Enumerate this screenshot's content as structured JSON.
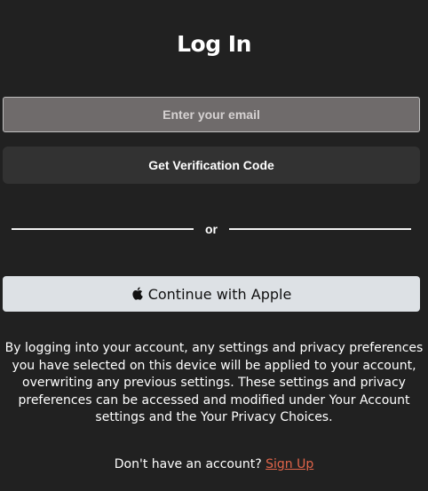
{
  "header": {
    "title": "Log In"
  },
  "form": {
    "email_placeholder": "Enter your email",
    "email_value": "",
    "verify_button_label": "Get Verification Code",
    "divider_text": "or",
    "apple_button_label": "Continue with Apple",
    "apple_icon": "apple-logo-icon"
  },
  "disclaimer": {
    "text": "By logging into your account, any settings and privacy preferences you have selected on this device will be applied to your account, overwriting any previous settings. These settings and privacy preferences can be accessed and modified under Your Account settings and the Your Privacy Choices."
  },
  "footer": {
    "prompt": "Don't have an account?",
    "signup_label": "Sign Up"
  },
  "colors": {
    "background": "#212121",
    "input_bg": "#6f6b6b",
    "secondary_button_bg": "#323232",
    "apple_button_bg": "#dde1e5",
    "link": "#e1654a"
  }
}
